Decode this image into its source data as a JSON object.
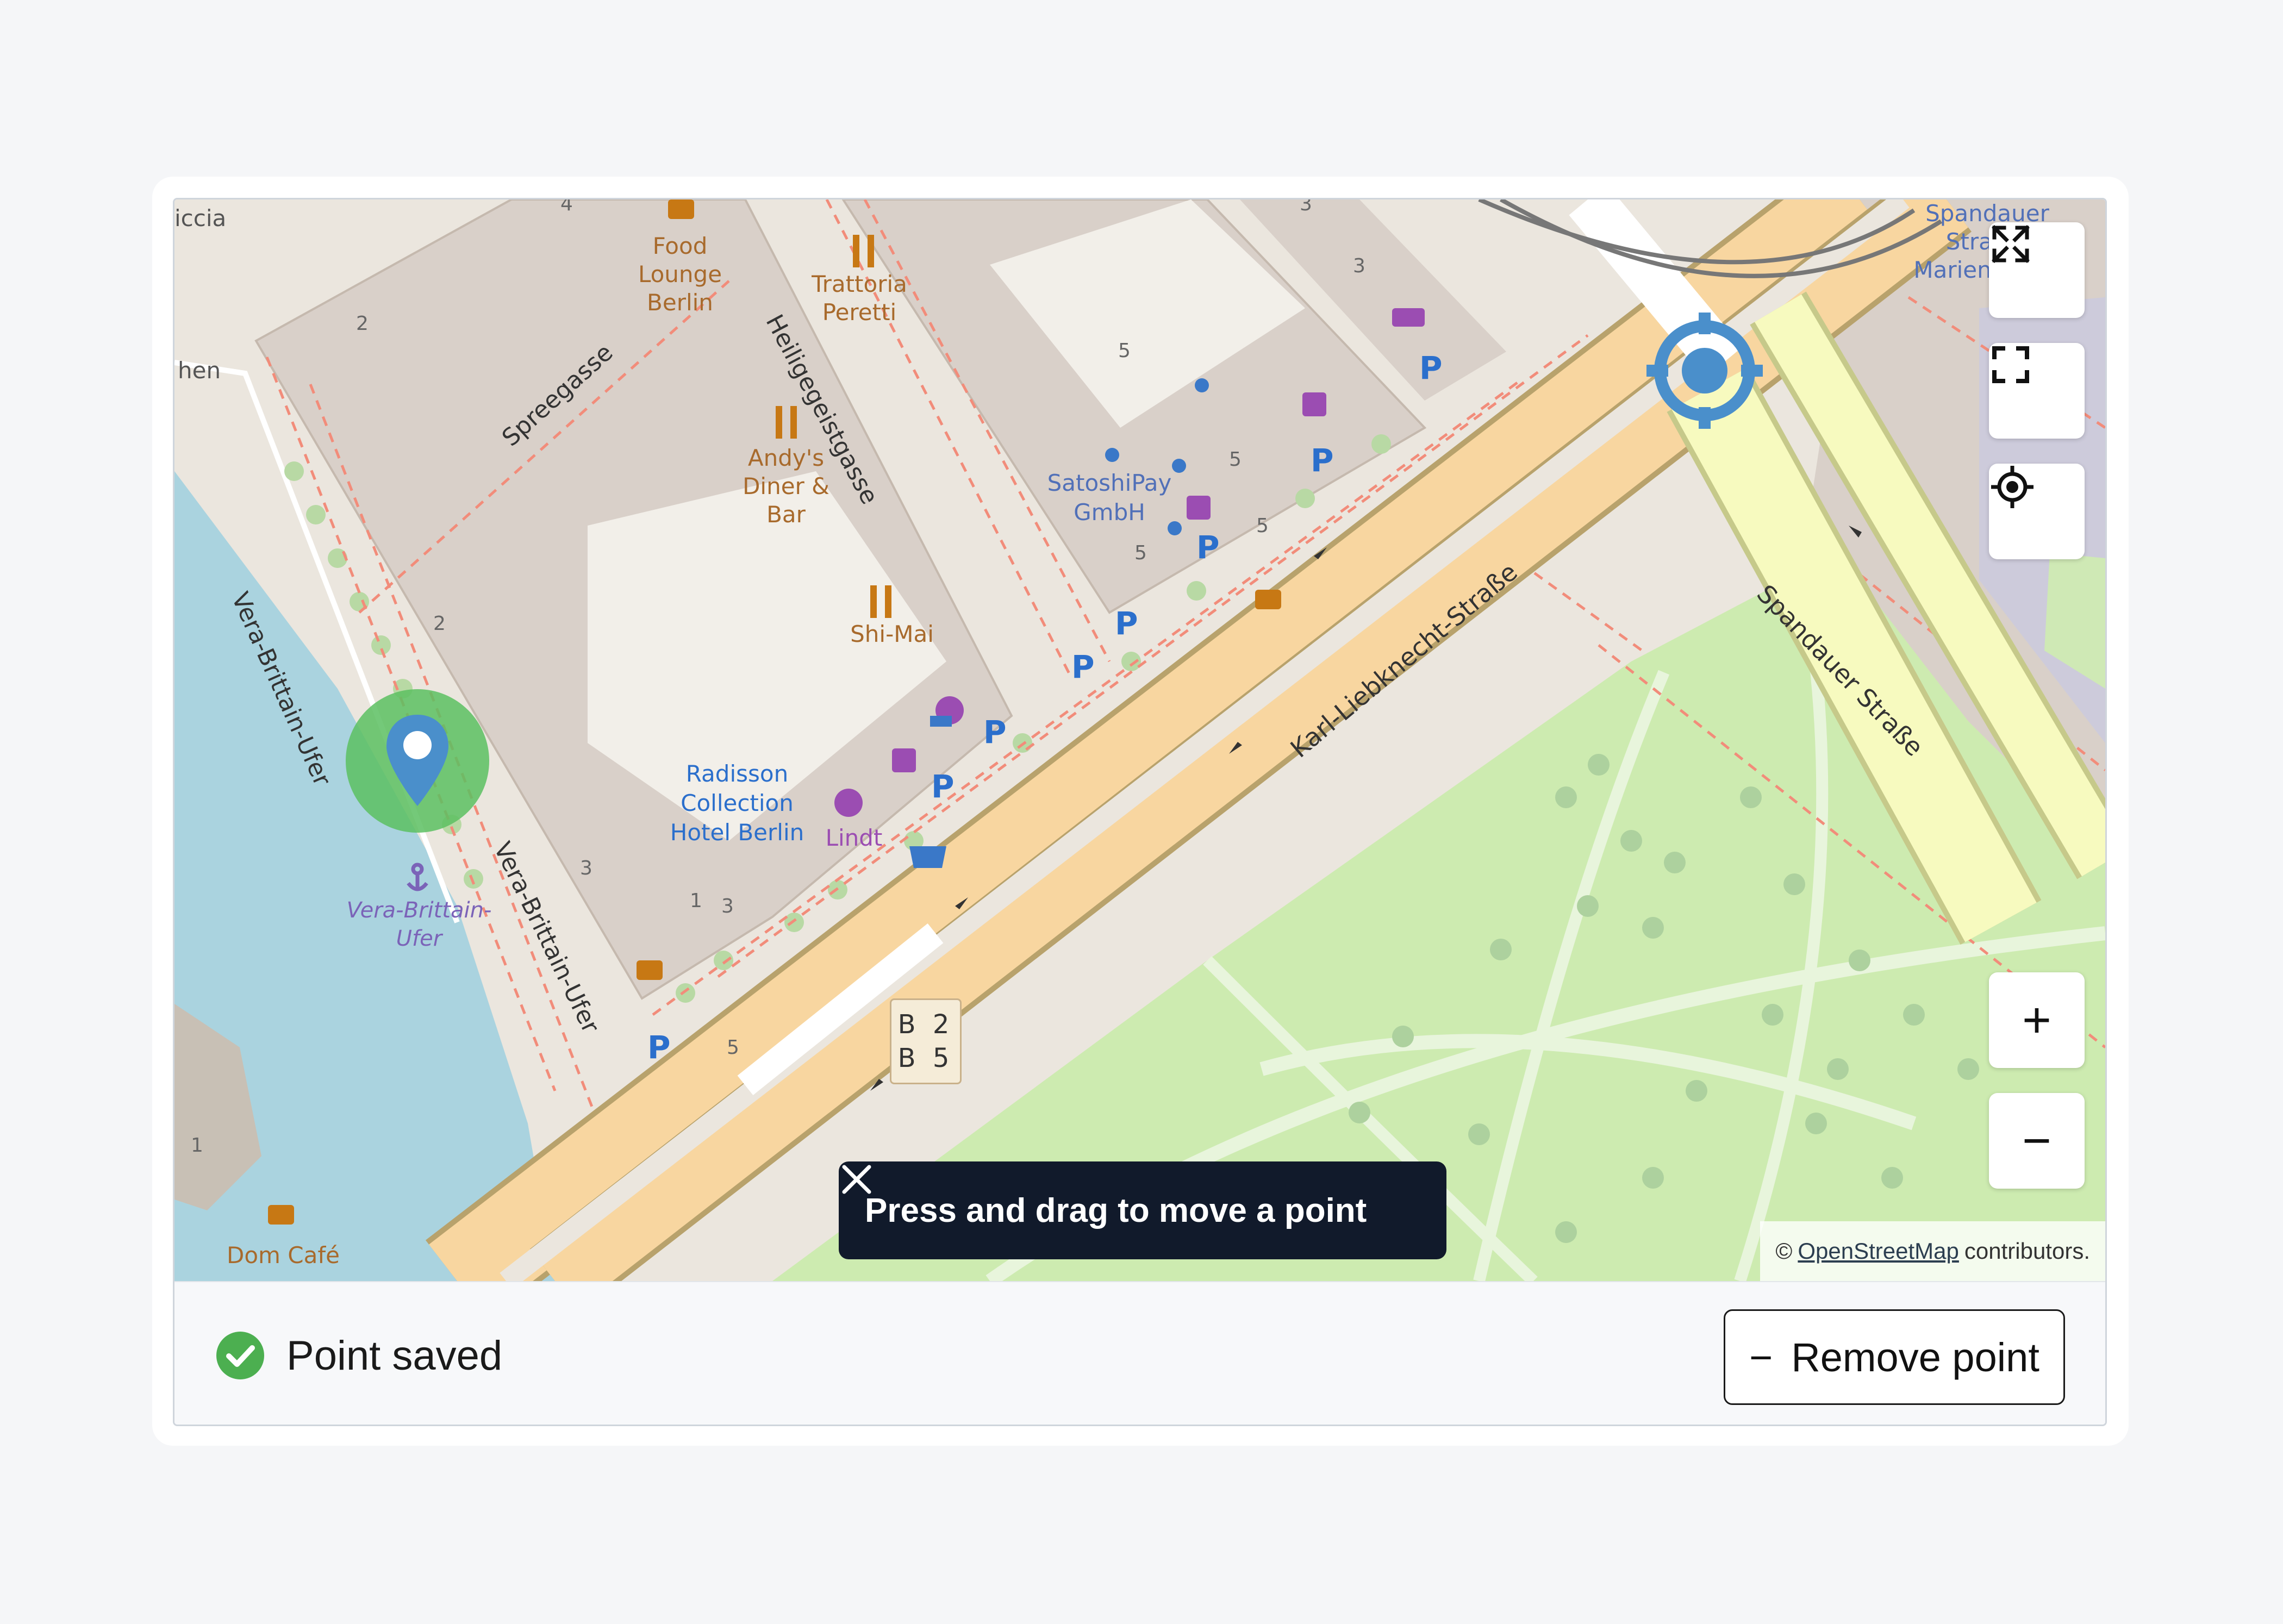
{
  "map": {
    "labels": {
      "food_lounge": "Food Lounge Berlin",
      "trattoria": "Trattoria Peretti",
      "andys": "Andy's Diner & Bar",
      "shi_mai": "Shi-Mai",
      "satoshipay": "SatoshiPay GmbH",
      "radisson": "Radisson Collection Hotel Berlin",
      "lindt": "Lindt",
      "vera_poi": "Vera-Brittain-Ufer",
      "dom_cafe": "Dom Café",
      "spandauer_mk": "Spandauer Straße/ Marienkirche",
      "street_spreegasse": "Spreegasse",
      "street_heiligegeist": "Heiligegeistgasse",
      "street_vera1": "Vera-Brittain-Ufer",
      "street_vera2": "Vera-Brittain-Ufer",
      "street_karl": "Karl-Liebknecht-Straße",
      "street_spandauer": "Spandauer Straße",
      "route_shield_1": "B 2",
      "route_shield_2": "B 5",
      "edge_iccia": "iccia",
      "edge_hen": "hen"
    },
    "housenumbers": [
      "4",
      "2",
      "2",
      "3",
      "1",
      "3",
      "5",
      "5",
      "5",
      "5",
      "3",
      "3",
      "1",
      "5"
    ]
  },
  "controls": {
    "expand_icon": "expand-arrows-icon",
    "fullscreen_icon": "fullscreen-corners-icon",
    "locate_icon": "locate-crosshair-icon",
    "zoom_in": "+",
    "zoom_out": "−"
  },
  "toast": {
    "message": "Press and drag to move a point",
    "close_icon": "close-icon"
  },
  "attribution": {
    "prefix": "©",
    "link": "OpenStreetMap",
    "suffix": "contributors."
  },
  "footer": {
    "status_text": "Point saved",
    "status_icon": "check-circle-icon",
    "remove_label": "Remove point",
    "remove_icon": "minus-icon"
  },
  "colors": {
    "accent": "#4a8fcb",
    "success": "#4caf50",
    "toast_bg": "#111a2b",
    "park": "#cdebb0",
    "water": "#aad3df",
    "road_trunk": "#f8d6a0",
    "road_secondary": "#f7fabf"
  }
}
